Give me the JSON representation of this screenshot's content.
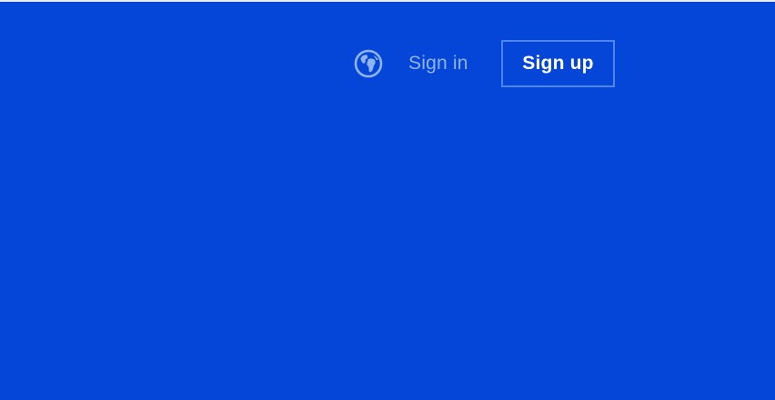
{
  "header": {
    "language_icon": "globe-icon",
    "sign_in_label": "Sign in",
    "sign_up_label": "Sign up"
  },
  "colors": {
    "background": "#0546d9",
    "sign_in_text": "#8fb4f2",
    "sign_up_border": "#4d86ea",
    "sign_up_text": "#ffffff",
    "icon": "#8fb4f2"
  }
}
